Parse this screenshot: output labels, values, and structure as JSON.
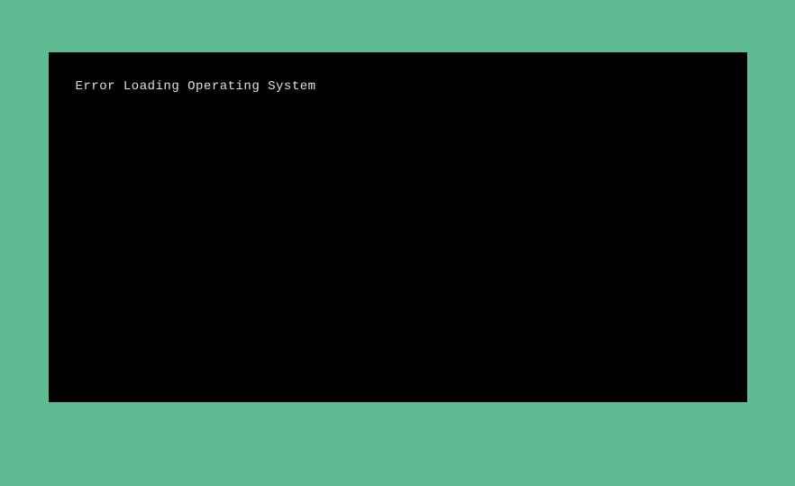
{
  "terminal": {
    "error_message": "Error Loading Operating System"
  }
}
